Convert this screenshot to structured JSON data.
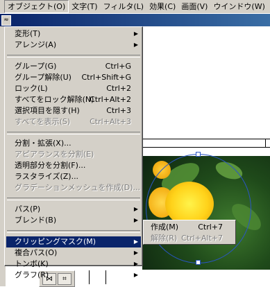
{
  "menubar": {
    "items": [
      {
        "label": "オブジェクト(O)",
        "active": true
      },
      {
        "label": "文字(T)",
        "active": false
      },
      {
        "label": "フィルタ(L)",
        "active": false
      },
      {
        "label": "効果(C)",
        "active": false
      },
      {
        "label": "画面(V)",
        "active": false
      },
      {
        "label": "ウインドウ(W)",
        "active": false
      }
    ]
  },
  "object_menu": {
    "items": [
      {
        "label": "変形(T)",
        "shortcut": "",
        "submenu": true,
        "disabled": false
      },
      {
        "label": "アレンジ(A)",
        "shortcut": "",
        "submenu": true,
        "disabled": false
      },
      {
        "label": "グループ(G)",
        "shortcut": "Ctrl+G",
        "submenu": false,
        "disabled": false
      },
      {
        "label": "グループ解除(U)",
        "shortcut": "Ctrl+Shift+G",
        "submenu": false,
        "disabled": false
      },
      {
        "label": "ロック(L)",
        "shortcut": "Ctrl+2",
        "submenu": false,
        "disabled": false
      },
      {
        "label": "すべてをロック解除(N)",
        "shortcut": "Ctrl+Alt+2",
        "submenu": false,
        "disabled": false
      },
      {
        "label": "選択項目を隠す(H)",
        "shortcut": "Ctrl+3",
        "submenu": false,
        "disabled": false
      },
      {
        "label": "すべてを表示(S)",
        "shortcut": "Ctrl+Alt+3",
        "submenu": false,
        "disabled": true
      },
      {
        "label": "分割・拡張(X)...",
        "shortcut": "",
        "submenu": false,
        "disabled": false
      },
      {
        "label": "アピアランスを分割(E)",
        "shortcut": "",
        "submenu": false,
        "disabled": true
      },
      {
        "label": "透明部分を分割(F)...",
        "shortcut": "",
        "submenu": false,
        "disabled": false
      },
      {
        "label": "ラスタライズ(Z)...",
        "shortcut": "",
        "submenu": false,
        "disabled": false
      },
      {
        "label": "グラデーションメッシュを作成(D)...",
        "shortcut": "",
        "submenu": false,
        "disabled": true
      },
      {
        "label": "パス(P)",
        "shortcut": "",
        "submenu": true,
        "disabled": false
      },
      {
        "label": "ブレンド(B)",
        "shortcut": "",
        "submenu": true,
        "disabled": false
      },
      {
        "label": "クリッピングマスク(M)",
        "shortcut": "",
        "submenu": true,
        "disabled": false,
        "highlighted": true
      },
      {
        "label": "複合パス(O)",
        "shortcut": "",
        "submenu": true,
        "disabled": false
      },
      {
        "label": "トンボ(K)",
        "shortcut": "",
        "submenu": true,
        "disabled": false
      },
      {
        "label": "グラフ(R)",
        "shortcut": "",
        "submenu": true,
        "disabled": false
      }
    ]
  },
  "clipping_submenu": {
    "items": [
      {
        "label": "作成(M)",
        "shortcut": "Ctrl+7",
        "disabled": false
      },
      {
        "label": "解除(R)",
        "shortcut": "Ctrl+Alt+7",
        "disabled": true
      }
    ]
  },
  "colors": {
    "menu_bg": "#d4d0c8",
    "highlight": "#0a246a",
    "disabled_text": "#808080",
    "selection": "#2a56c6"
  },
  "icons": {
    "submenu_arrow": "▶",
    "arrow_glyph": "▶"
  }
}
